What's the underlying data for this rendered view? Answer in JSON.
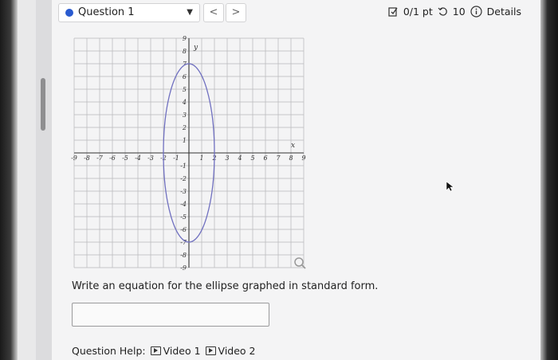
{
  "topbar": {
    "question_label": "Question 1",
    "caret": "▼",
    "prev_symbol": "<",
    "next_symbol": ">",
    "score": "0/1 pt",
    "retries": "10",
    "details": "Details"
  },
  "graph": {
    "x_label": "x",
    "y_label": "y",
    "x_ticks": [
      "-9",
      "-8",
      "-7",
      "-6",
      "-5",
      "-4",
      "-3",
      "-2",
      "-1",
      "1",
      "2",
      "3",
      "4",
      "5",
      "6",
      "7",
      "8",
      "9"
    ],
    "y_ticks": [
      "9",
      "8",
      "7",
      "6",
      "5",
      "4",
      "3",
      "2",
      "1",
      "-1",
      "-2",
      "-3",
      "-4",
      "-5",
      "-6",
      "-7",
      "-8",
      "-9"
    ],
    "x_range": [
      -9,
      9
    ],
    "y_range": [
      -9,
      9
    ],
    "ellipse": {
      "center": [
        0,
        0
      ],
      "a": 2,
      "b": 7
    },
    "ellipse_color": "#7070c0",
    "zoom_icon": "magnifier-icon"
  },
  "prompt": "Write an equation for the ellipse graphed in standard form.",
  "answer_value": "",
  "help": {
    "label": "Question Help:",
    "video1": "Video 1",
    "video2": "Video 2"
  },
  "colors": {
    "accent": "#2a5bd0",
    "grid": "#b7b7ba",
    "axis": "#333333"
  }
}
